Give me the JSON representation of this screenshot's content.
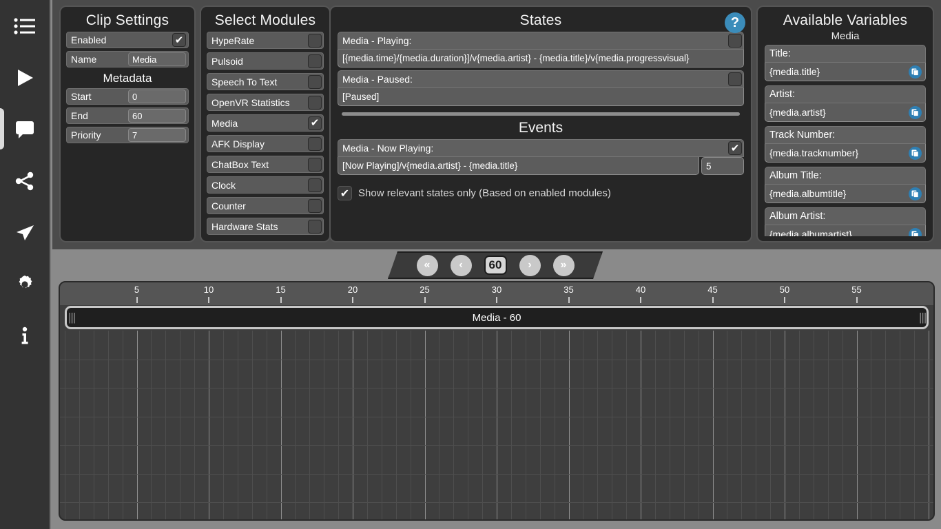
{
  "sidebar": {
    "items": [
      {
        "icon": "list-icon",
        "name": "sidebar-item-modules"
      },
      {
        "icon": "play-icon",
        "name": "sidebar-item-run"
      },
      {
        "icon": "chat-bubble-icon",
        "name": "sidebar-item-chatbox"
      },
      {
        "icon": "share-icon",
        "name": "sidebar-item-router"
      },
      {
        "icon": "send-icon",
        "name": "sidebar-item-startup"
      },
      {
        "icon": "gear-icon",
        "name": "sidebar-item-settings"
      },
      {
        "icon": "info-icon",
        "name": "sidebar-item-about"
      }
    ],
    "selected_index": 2
  },
  "clip_settings": {
    "title": "Clip Settings",
    "enabled_label": "Enabled",
    "enabled_checked": true,
    "name_label": "Name",
    "name_value": "Media",
    "metadata_label": "Metadata",
    "fields": [
      {
        "label": "Start",
        "value": "0"
      },
      {
        "label": "End",
        "value": "60"
      },
      {
        "label": "Priority",
        "value": "7"
      }
    ]
  },
  "select_modules": {
    "title": "Select Modules",
    "modules": [
      {
        "label": "HypeRate",
        "checked": false
      },
      {
        "label": "Pulsoid",
        "checked": false
      },
      {
        "label": "Speech To Text",
        "checked": false
      },
      {
        "label": "OpenVR Statistics",
        "checked": false
      },
      {
        "label": "Media",
        "checked": true
      },
      {
        "label": "AFK Display",
        "checked": false
      },
      {
        "label": "ChatBox Text",
        "checked": false
      },
      {
        "label": "Clock",
        "checked": false
      },
      {
        "label": "Counter",
        "checked": false
      },
      {
        "label": "Hardware Stats",
        "checked": false
      }
    ]
  },
  "states": {
    "title": "States",
    "help_icon": "question-mark-icon",
    "items": [
      {
        "label": "Media - Playing:",
        "checked": false,
        "value": "[{media.time}/{media.duration}]/v{media.artist} - {media.title}/v{media.progressvisual}"
      },
      {
        "label": "Media - Paused:",
        "checked": false,
        "value": "[Paused]"
      }
    ]
  },
  "events": {
    "title": "Events",
    "items": [
      {
        "label": "Media - Now Playing:",
        "checked": true,
        "value": "[Now Playing]/v{media.artist} - {media.title}",
        "duration": "5"
      }
    ],
    "show_relevant_label": "Show relevant states only (Based on enabled modules)",
    "show_relevant_checked": true
  },
  "available_variables": {
    "title": "Available Variables",
    "subtitle": "Media",
    "copy_icon": "copy-icon",
    "variables": [
      {
        "label": "Title:",
        "value": "{media.title}"
      },
      {
        "label": "Artist:",
        "value": "{media.artist}"
      },
      {
        "label": "Track Number:",
        "value": "{media.tracknumber}"
      },
      {
        "label": "Album Title:",
        "value": "{media.albumtitle}"
      },
      {
        "label": "Album Artist:",
        "value": "{media.albumartist}"
      }
    ]
  },
  "navbar": {
    "first_label": "«",
    "prev_label": "‹",
    "value": "60",
    "next_label": "›",
    "last_label": "»"
  },
  "timeline": {
    "clip_label": "Media - 60",
    "ticks": [
      5,
      10,
      15,
      20,
      25,
      30,
      35,
      40,
      45,
      50,
      55
    ],
    "total_seconds": 60,
    "clip_start": 0,
    "clip_end": 60
  },
  "colors": {
    "accent_blue": "#3b8cba",
    "copy_blue": "#2e7fb3",
    "panel_bg": "#262626",
    "page_bg": "#4b4b4b",
    "sidebar_bg": "#333333"
  }
}
